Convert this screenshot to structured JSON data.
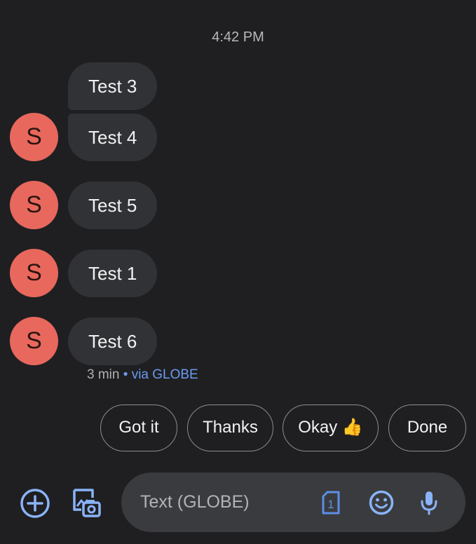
{
  "conversation": {
    "timestamp": "4:42 PM",
    "messages": [
      {
        "text": "Test 3",
        "avatar": ""
      },
      {
        "text": "Test 4",
        "avatar": "S"
      },
      {
        "text": "Test 5",
        "avatar": "S"
      },
      {
        "text": "Test 1",
        "avatar": "S"
      },
      {
        "text": "Test 6",
        "avatar": "S"
      }
    ],
    "meta": {
      "age": "3 min",
      "separator": "•",
      "via": "via GLOBE"
    }
  },
  "smart_replies": [
    "Got it",
    "Thanks",
    "Okay 👍",
    "Done"
  ],
  "composer": {
    "placeholder": "Text (GLOBE)",
    "sim_number": "1",
    "icons": {
      "add": "add-circle-icon",
      "gallery": "gallery-camera-icon",
      "sim": "sim-card-icon",
      "emoji": "emoji-icon",
      "mic": "microphone-icon"
    }
  },
  "colors": {
    "background": "#1f1f22",
    "bubble": "#313236",
    "avatar": "#e8685d",
    "accent": "#8ab4f8",
    "link": "#6a9bf0",
    "composer": "#3a3b3f"
  }
}
